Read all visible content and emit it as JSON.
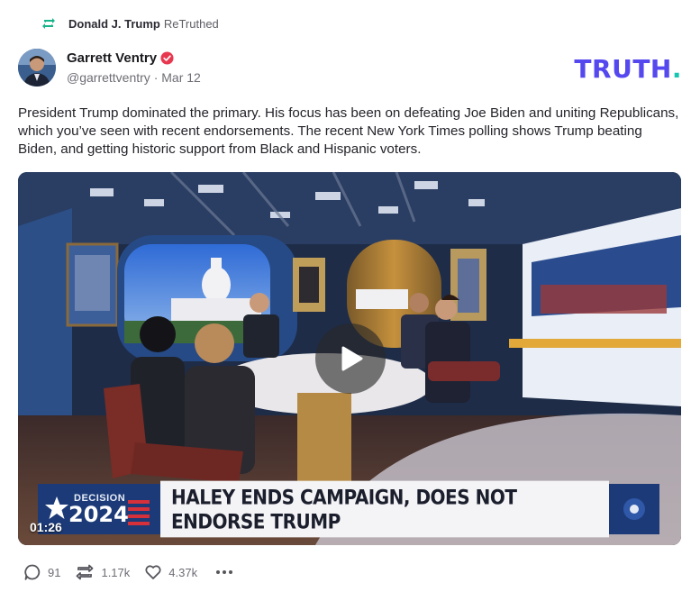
{
  "retruth": {
    "user": "Donald J. Trump",
    "label": "ReTruthed",
    "icon": "retruth-icon"
  },
  "author": {
    "display_name": "Garrett Ventry",
    "handle": "@garrettventry",
    "date": "Mar 12",
    "verified": true,
    "avatar": "avatar-photo"
  },
  "brand": {
    "text": "TRUTH",
    "dot": ".",
    "color": "#5448EE",
    "dot_color": "#16C6B0"
  },
  "post": {
    "text": "President Trump dominated the primary. His focus has been on defeating Joe Biden and uniting Republicans, which you’ve seen with recent endorsements. The recent New York Times polling shows Trump beating Biden, and getting historic support from Black and Hispanic voters."
  },
  "video": {
    "duration": "01:26",
    "play_icon": "play-icon",
    "lower_third": {
      "decision_label": "DECISION",
      "year": "2024",
      "headline": "HALEY ENDS CAMPAIGN, DOES NOT ENDORSE TRUMP"
    }
  },
  "actions": {
    "replies": {
      "icon": "reply-icon",
      "count": "91"
    },
    "retruths": {
      "icon": "retruth-icon",
      "count": "1.17k"
    },
    "likes": {
      "icon": "heart-icon",
      "count": "4.37k"
    },
    "more": {
      "icon": "more-icon"
    }
  }
}
